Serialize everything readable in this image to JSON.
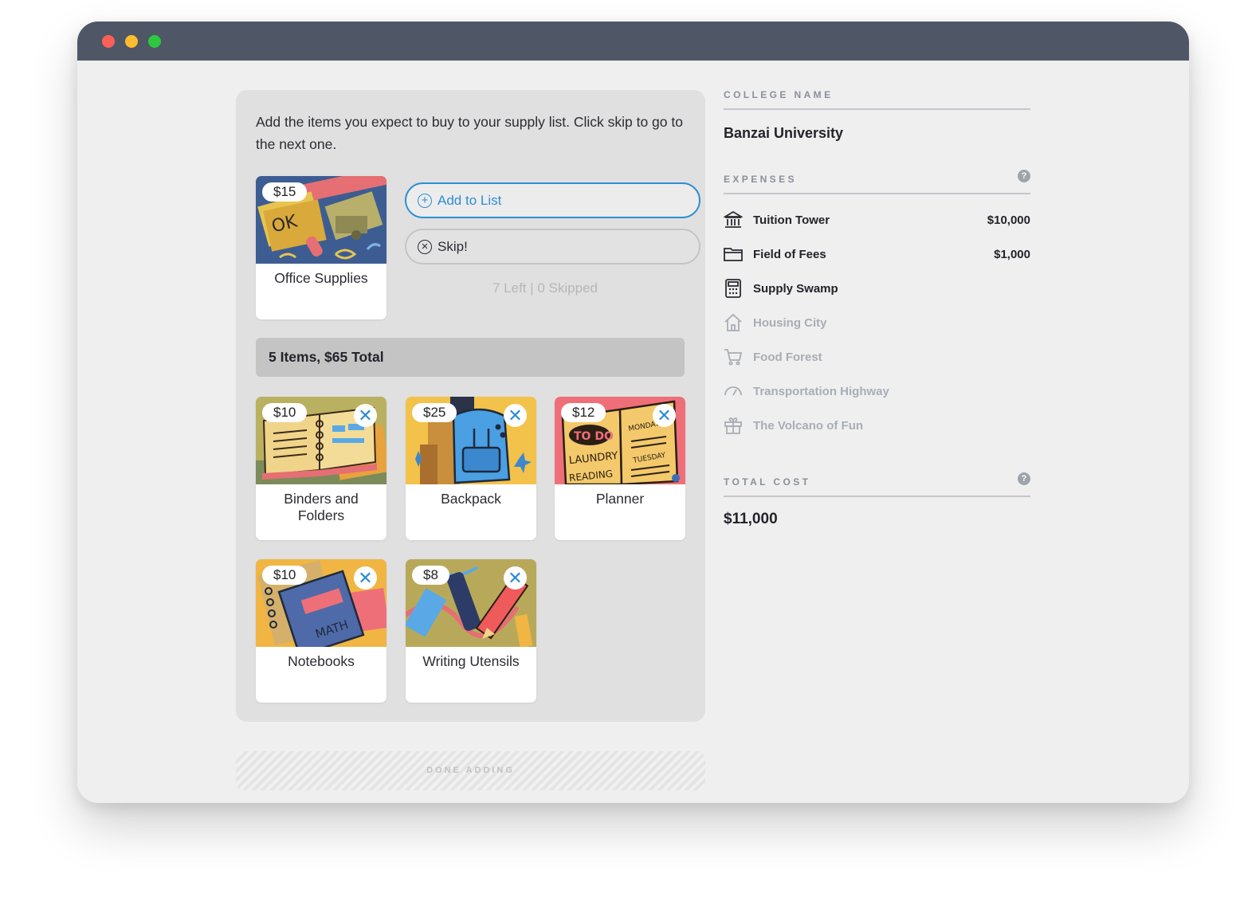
{
  "window": {
    "controls": [
      "close",
      "minimize",
      "zoom"
    ]
  },
  "activity": {
    "instructions": "Add the items you expect to buy to your supply list. Click skip to go to the next one.",
    "current_item": {
      "price": "$15",
      "name": "Office Supplies",
      "icon": "office-supplies-illustration"
    },
    "add_button": "Add to List",
    "skip_button": "Skip!",
    "progress": "7 Left | 0 Skipped",
    "summary": "5 Items, $65 Total",
    "items": [
      {
        "price": "$10",
        "name": "Binders and Folders",
        "icon": "binder-illustration"
      },
      {
        "price": "$25",
        "name": "Backpack",
        "icon": "backpack-illustration"
      },
      {
        "price": "$12",
        "name": "Planner",
        "icon": "planner-illustration"
      },
      {
        "price": "$10",
        "name": "Notebooks",
        "icon": "notebook-illustration"
      },
      {
        "price": "$8",
        "name": "Writing Utensils",
        "icon": "pencils-illustration"
      }
    ],
    "done_button": "DONE ADDING"
  },
  "sidebar": {
    "college_heading": "COLLEGE NAME",
    "college_name": "Banzai University",
    "expenses_heading": "EXPENSES",
    "expenses": [
      {
        "name": "Tuition Tower",
        "value": "$10,000",
        "icon": "bank-icon",
        "active": true
      },
      {
        "name": "Field of Fees",
        "value": "$1,000",
        "icon": "folder-icon",
        "active": true
      },
      {
        "name": "Supply Swamp",
        "value": "",
        "icon": "calculator-icon",
        "active": true
      },
      {
        "name": "Housing City",
        "value": "",
        "icon": "house-icon",
        "active": false
      },
      {
        "name": "Food Forest",
        "value": "",
        "icon": "cart-icon",
        "active": false
      },
      {
        "name": "Transportation Highway",
        "value": "",
        "icon": "speedometer-icon",
        "active": false
      },
      {
        "name": "The Volcano of Fun",
        "value": "",
        "icon": "gift-icon",
        "active": false
      }
    ],
    "total_heading": "TOTAL COST",
    "total_value": "$11,000"
  },
  "colors": {
    "accent": "#2d8fd3",
    "titlebar": "#4f5666",
    "panel": "#e0e0e0",
    "summary_bar": "#c4c4c4"
  }
}
